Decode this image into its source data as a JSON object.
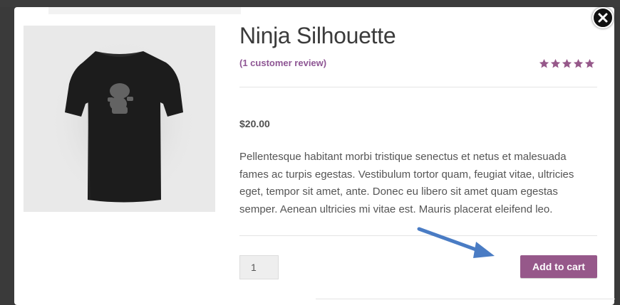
{
  "product": {
    "title": "Ninja Silhouette",
    "review_link": "(1 customer review)",
    "rating": 5,
    "rating_max": 5,
    "price": "$20.00",
    "description": "Pellentesque habitant morbi tristique senectus et netus et malesuada fames ac turpis egestas. Vestibulum tortor quam, feugiat vitae, ultricies eget, tempor sit amet, ante. Donec eu libero sit amet quam egestas semper. Aenean ultricies mi vitae est. Mauris placerat eleifend leo.",
    "quantity": "1",
    "add_to_cart_label": "Add to cart"
  },
  "icons": {
    "close": "close-icon",
    "star": "star-icon",
    "annotation_arrow": "arrow-icon"
  },
  "colors": {
    "accent": "#96588a",
    "review_link": "#8e5694",
    "annotation_arrow": "#4a7cc4",
    "overlay": "#3a3a3a"
  }
}
